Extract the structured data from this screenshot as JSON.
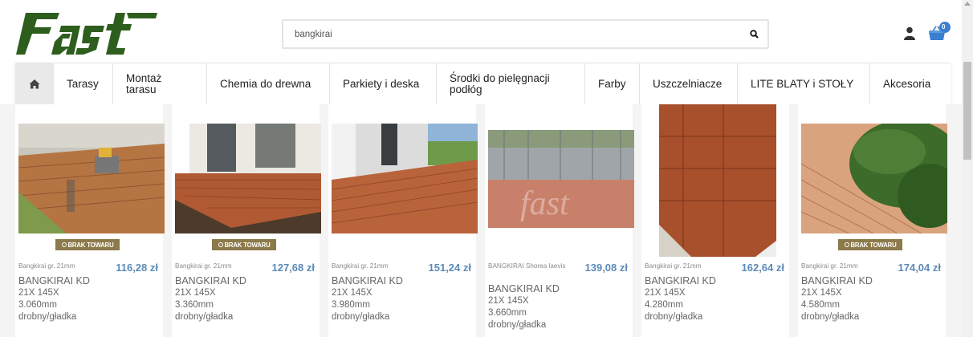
{
  "header": {
    "logo_text": "fast",
    "search": {
      "value": "bangkirai",
      "placeholder": ""
    },
    "cart_count": "0"
  },
  "nav": {
    "items": [
      "Tarasy",
      "Montaż tarasu",
      "Chemia do drewna",
      "Parkiety i deska",
      "Środki do pielęgnacji podłóg",
      "Farby",
      "Uszczelniacze",
      "LITE BLATY i STOŁY",
      "Akcesoria"
    ]
  },
  "products": [
    {
      "badge": "BRAK TOWARU",
      "meta": "Bangkirai gr. 21mm",
      "price": "116,28 zł",
      "name": "BANGKIRAI KD",
      "size1": "21X 145X",
      "size2": "3.060mm",
      "finish": "drobny/gładka"
    },
    {
      "badge": "BRAK TOWARU",
      "meta": "Bangkirai gr. 21mm",
      "price": "127,68 zł",
      "name": "BANGKIRAI KD",
      "size1": "21X 145X",
      "size2": "3.360mm",
      "finish": "drobny/gładka"
    },
    {
      "badge": "",
      "meta": "Bangkirai gr. 21mm",
      "price": "151,24 zł",
      "name": "BANGKIRAI KD",
      "size1": "21X 145X",
      "size2": "3.980mm",
      "finish": "drobny/gładka"
    },
    {
      "badge": "",
      "meta": "BANGKIRAI Shorea laevis",
      "price": "139,08 zł",
      "name": "BANGKIRAI KD",
      "size1": "21X 145X",
      "size2": "3.660mm",
      "finish": "drobny/gładka"
    },
    {
      "badge": "",
      "meta": "Bangkirai gr. 21mm",
      "price": "162,64 zł",
      "name": "BANGKIRAI KD",
      "size1": "21X 145X",
      "size2": "4.280mm",
      "finish": "drobny/gładka"
    },
    {
      "badge": "BRAK TOWARU",
      "meta": "Bangkirai gr. 21mm",
      "price": "174,04 zł",
      "name": "BANGKIRAI KD",
      "size1": "21X 145X",
      "size2": "4.580mm",
      "finish": "drobny/gładka"
    }
  ],
  "colors": {
    "logo": "#2e5e1e",
    "price": "#5b8bb7",
    "badge": "#8c7a4a",
    "wood": "#b5603a",
    "cart": "#3b7fd1"
  },
  "icons": [
    "search-icon",
    "user-icon",
    "cart-icon",
    "home-icon"
  ]
}
